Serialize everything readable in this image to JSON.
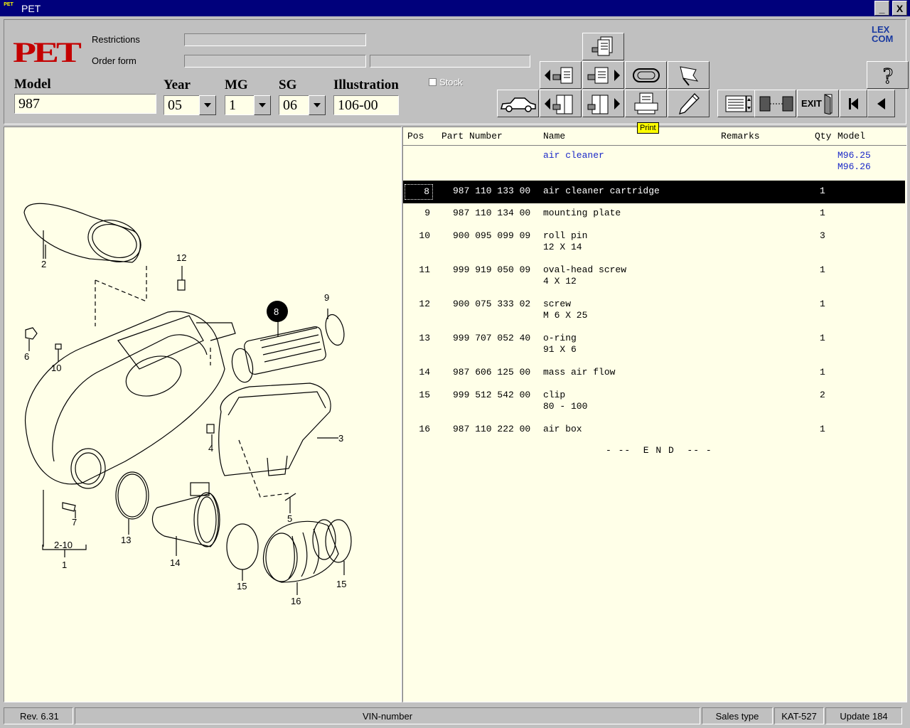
{
  "window": {
    "title": "PET",
    "app_icon": "PET",
    "minimize": "_",
    "close": "X"
  },
  "header": {
    "logo": "PET",
    "restrictions_label": "Restrictions",
    "order_form_label": "Order form",
    "model_label": "Model",
    "model_value": "987",
    "year_label": "Year",
    "year_value": "05",
    "mg_label": "MG",
    "mg_value": "1",
    "sg_label": "SG",
    "sg_value": "06",
    "illustration_label": "Illustration",
    "illustration_value": "106-00",
    "stock_label": "Stock",
    "lexcom_logo": "LEX\nCOM",
    "exit_label": "EXIT",
    "print_tooltip": "Print"
  },
  "illustration": {
    "callouts": [
      "2",
      "12",
      "9",
      "8",
      "6",
      "10",
      "3",
      "4",
      "7",
      "5",
      "13",
      "14",
      "15",
      "16",
      "15",
      "2-10",
      "1"
    ]
  },
  "parts": {
    "columns": {
      "pos": "Pos",
      "part_number": "Part Number",
      "name": "Name",
      "remarks": "Remarks",
      "qty": "Qty",
      "model": "Model"
    },
    "group": {
      "name": "air cleaner",
      "model1": "M96.25",
      "model2": "M96.26"
    },
    "rows": [
      {
        "pos": "8",
        "part": "987 110 133 00",
        "name": "air cleaner cartridge",
        "name2": "",
        "qty": "1"
      },
      {
        "pos": "9",
        "part": "987 110 134 00",
        "name": "mounting plate",
        "name2": "",
        "qty": "1"
      },
      {
        "pos": "10",
        "part": "900 095 099 09",
        "name": "roll pin",
        "name2": "12 X 14",
        "qty": "3"
      },
      {
        "pos": "11",
        "part": "999 919 050 09",
        "name": "oval-head screw",
        "name2": "4 X 12",
        "qty": "1"
      },
      {
        "pos": "12",
        "part": "900 075 333 02",
        "name": "screw",
        "name2": "M 6 X 25",
        "qty": "1"
      },
      {
        "pos": "13",
        "part": "999 707 052 40",
        "name": "o-ring",
        "name2": "91 X 6",
        "qty": "1"
      },
      {
        "pos": "14",
        "part": "987 606 125 00",
        "name": "mass air flow",
        "name2": "",
        "qty": "1"
      },
      {
        "pos": "15",
        "part": "999 512 542 00",
        "name": "clip",
        "name2": "80 - 100",
        "qty": "2"
      },
      {
        "pos": "16",
        "part": "987 110 222 00",
        "name": "air box",
        "name2": "",
        "qty": "1"
      }
    ],
    "end_marker": "- --  E N D  -- -"
  },
  "status": {
    "rev": "Rev. 6.31",
    "vin": "VIN-number",
    "sales_type": "Sales type",
    "kat": "KAT-527",
    "update": "Update 184"
  }
}
